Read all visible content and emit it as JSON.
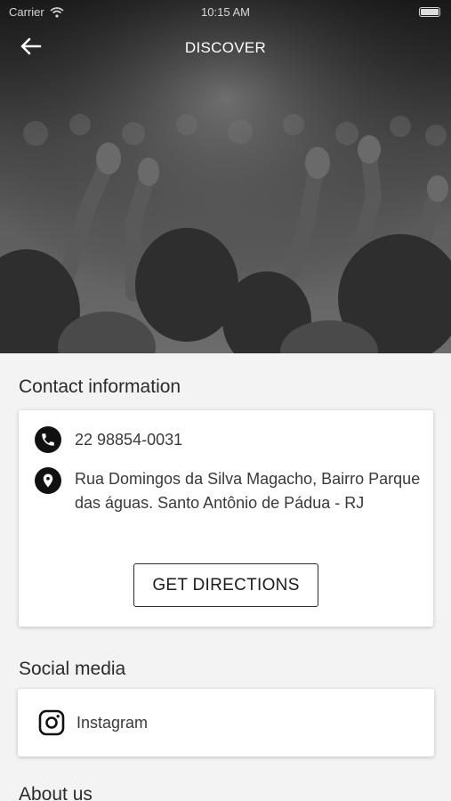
{
  "status_bar": {
    "carrier": "Carrier",
    "time": "10:15 AM"
  },
  "nav": {
    "title": "DISCOVER"
  },
  "contact": {
    "heading": "Contact information",
    "phone": "22 98854-0031",
    "address": "Rua Domingos da Silva Magacho, Bairro Parque das águas. Santo Antônio de Pádua - RJ",
    "directions_label": "GET DIRECTIONS"
  },
  "social": {
    "heading": "Social media",
    "items": [
      {
        "label": "Instagram",
        "icon": "instagram-icon"
      }
    ]
  },
  "about": {
    "heading": "About us"
  },
  "icons": {
    "back": "arrow-left-icon",
    "phone": "phone-icon",
    "address": "map-pin-icon",
    "wifi": "wifi-icon",
    "battery": "battery-icon"
  },
  "colors": {
    "icon_fill": "#111111",
    "page_bg": "#f3f3f3",
    "card_bg": "#ffffff",
    "text": "#2b2b2b"
  }
}
